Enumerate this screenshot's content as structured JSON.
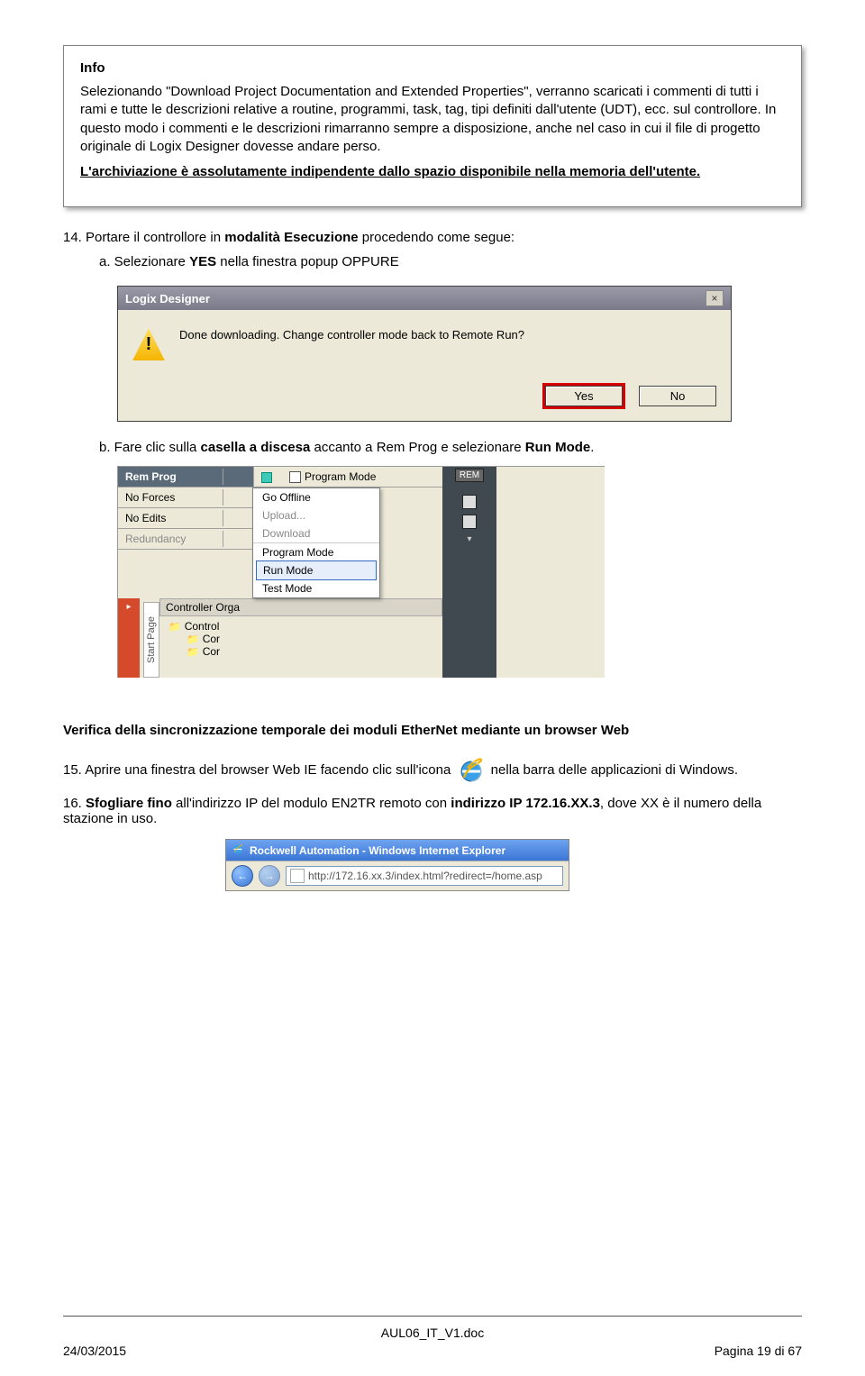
{
  "info_box": {
    "heading": "Info",
    "paragraph": "Selezionando \"Download Project Documentation and Extended Properties\", verranno scaricati i commenti di tutti i rami e tutte le descrizioni relative a routine, programmi, task, tag, tipi definiti dall'utente (UDT), ecc. sul controllore. In questo modo i commenti e le descrizioni rimarranno sempre a disposizione, anche nel caso in cui il file di progetto originale di Logix Designer dovesse andare perso.",
    "emph": "L'archiviazione è assolutamente indipendente dallo spazio disponibile nella memoria dell'utente."
  },
  "step14": {
    "num": "14.",
    "text_a": "Portare il controllore in ",
    "text_bold": "modalità Esecuzione",
    "text_b": " procedendo come segue:",
    "sub_a_pre": "a. Selezionare ",
    "sub_a_bold": "YES",
    "sub_a_post": " nella finestra popup OPPURE",
    "sub_b_pre": "b. Fare clic sulla ",
    "sub_b_bold1": "casella a discesa",
    "sub_b_mid": " accanto a Rem Prog e selezionare ",
    "sub_b_bold2": "Run Mode",
    "sub_b_end": "."
  },
  "dialog1": {
    "title": "Logix Designer",
    "message": "Done downloading. Change controller mode back to Remote Run?",
    "yes": "Yes",
    "no": "No"
  },
  "toolbar": {
    "rem_prog": "Rem Prog",
    "no_forces": "No Forces",
    "no_edits": "No Edits",
    "redundancy": "Redundancy",
    "program_mode_chk": "Program Mode",
    "rem_badge": "REM"
  },
  "menu": {
    "go_offline": "Go Offline",
    "upload": "Upload...",
    "download": "Download",
    "program_mode": "Program Mode",
    "run_mode": "Run Mode",
    "test_mode": "Test Mode"
  },
  "tree": {
    "start_page": "Start Page",
    "title": "Controller Orga",
    "node1": "Control",
    "node2": "Cor",
    "node3": "Cor"
  },
  "section_heading": "Verifica della sincronizzazione temporale dei moduli EtherNet mediante un browser Web",
  "step15": {
    "num": "15.",
    "text_a": "Aprire una finestra del browser Web IE facendo clic sull'icona ",
    "text_b": " nella barra delle applicazioni di Windows."
  },
  "step16": {
    "num": "16.",
    "text_a": "Sfogliare fino ",
    "text_b": "all'indirizzo IP del modulo EN2TR remoto con ",
    "bold": "indirizzo IP 172.16.XX.3",
    "text_c": ", dove XX è il numero della stazione in uso."
  },
  "ie": {
    "title": "Rockwell Automation - Windows Internet Explorer",
    "url": "http://172.16.xx.3/index.html?redirect=/home.asp"
  },
  "footer": {
    "doc": "AUL06_IT_V1.doc",
    "date": "24/03/2015",
    "page": "Pagina 19 di 67"
  }
}
